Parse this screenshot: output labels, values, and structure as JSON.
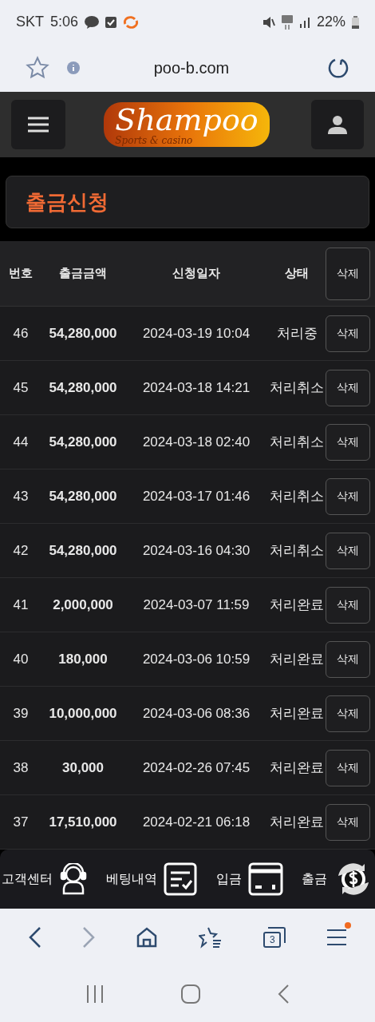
{
  "status_bar": {
    "carrier": "SKT",
    "time": "5:06",
    "battery": "22%"
  },
  "address_bar": {
    "url": "poo-b.com"
  },
  "header": {
    "logo": "Shampoo",
    "logo_tagline": "Sports & casino"
  },
  "page_title": "출금신청",
  "table": {
    "columns": [
      "번호",
      "출금금액",
      "신청일자",
      "상태"
    ],
    "delete_header": "삭제",
    "rows": [
      {
        "no": "46",
        "amount": "54,280,000",
        "date": "2024-03-19 10:04",
        "status": "처리중",
        "delete": "삭제"
      },
      {
        "no": "45",
        "amount": "54,280,000",
        "date": "2024-03-18 14:21",
        "status": "처리취소",
        "delete": "삭제"
      },
      {
        "no": "44",
        "amount": "54,280,000",
        "date": "2024-03-18 02:40",
        "status": "처리취소",
        "delete": "삭제"
      },
      {
        "no": "43",
        "amount": "54,280,000",
        "date": "2024-03-17 01:46",
        "status": "처리취소",
        "delete": "삭제"
      },
      {
        "no": "42",
        "amount": "54,280,000",
        "date": "2024-03-16 04:30",
        "status": "처리취소",
        "delete": "삭제"
      },
      {
        "no": "41",
        "amount": "2,000,000",
        "date": "2024-03-07 11:59",
        "status": "처리완료",
        "delete": "삭제"
      },
      {
        "no": "40",
        "amount": "180,000",
        "date": "2024-03-06 10:59",
        "status": "처리완료",
        "delete": "삭제"
      },
      {
        "no": "39",
        "amount": "10,000,000",
        "date": "2024-03-06 08:36",
        "status": "처리완료",
        "delete": "삭제"
      },
      {
        "no": "38",
        "amount": "30,000",
        "date": "2024-02-26 07:45",
        "status": "처리완료",
        "delete": "삭제"
      },
      {
        "no": "37",
        "amount": "17,510,000",
        "date": "2024-02-21 06:18",
        "status": "처리완료",
        "delete": "삭제"
      }
    ]
  },
  "bottom_menu": [
    {
      "label": "고객센터",
      "kind": "support"
    },
    {
      "label": "베팅내역",
      "kind": "history"
    },
    {
      "label": "입금",
      "kind": "deposit"
    },
    {
      "label": "출금",
      "kind": "withdraw"
    }
  ],
  "browser_toolbar": {
    "tab_count": "3"
  }
}
